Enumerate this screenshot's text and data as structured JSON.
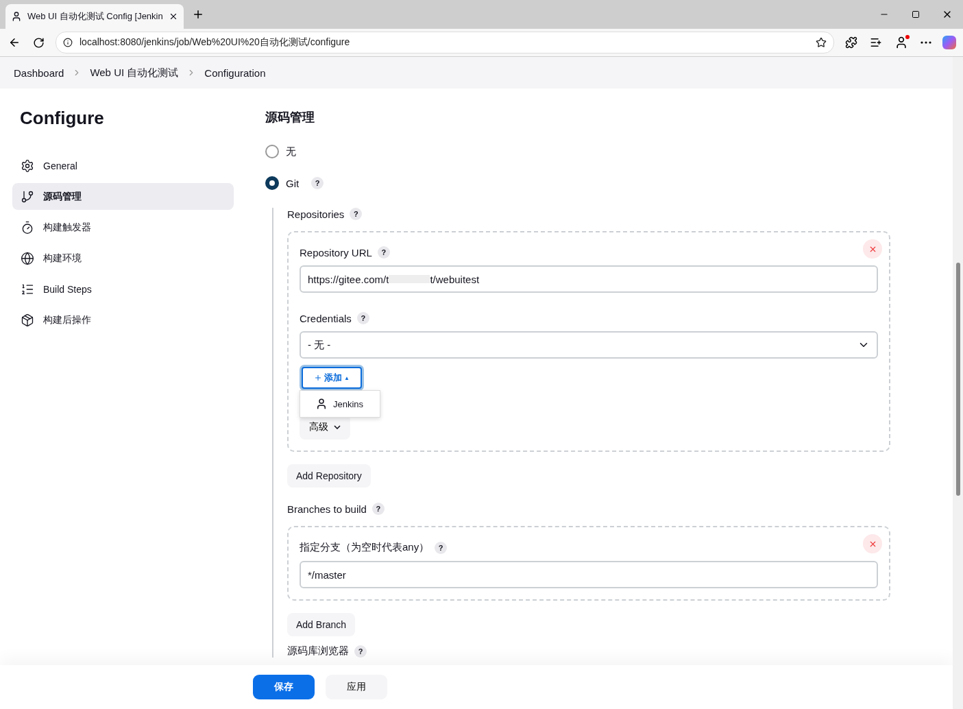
{
  "browser": {
    "tab_title": "Web UI 自动化测试 Config [Jenkin",
    "url": "localhost:8080/jenkins/job/Web%20UI%20自动化测试/configure"
  },
  "breadcrumbs": [
    "Dashboard",
    "Web UI 自动化测试",
    "Configuration"
  ],
  "sidebar": {
    "title": "Configure",
    "items": [
      {
        "label": "General",
        "selected": false
      },
      {
        "label": "源码管理",
        "selected": true
      },
      {
        "label": "构建触发器",
        "selected": false
      },
      {
        "label": "构建环境",
        "selected": false
      },
      {
        "label": "Build Steps",
        "selected": false
      },
      {
        "label": "构建后操作",
        "selected": false
      }
    ]
  },
  "scm": {
    "title": "源码管理",
    "options": [
      {
        "label": "无",
        "selected": false
      },
      {
        "label": "Git",
        "selected": true,
        "help": "?"
      }
    ],
    "repositories": {
      "label": "Repositories",
      "help": "?",
      "url_label": "Repository URL",
      "url_help": "?",
      "url_value": "https://gitee.com/t",
      "url_value_end": "t/webuitest",
      "credentials_label": "Credentials",
      "credentials_help": "?",
      "credentials_value": "- 无 -",
      "add_button": "添加",
      "add_caret": "▲",
      "add_menu": [
        "Jenkins"
      ],
      "advanced": "高级",
      "add_repository": "Add Repository"
    },
    "branches": {
      "label": "Branches to build",
      "help": "?",
      "spec_label": "指定分支（为空时代表any）",
      "spec_help": "?",
      "spec_value": "*/master",
      "add_branch": "Add Branch"
    },
    "browser_label": "源码库浏览器",
    "browser_help": "?"
  },
  "footer": {
    "save": "保存",
    "apply": "应用"
  }
}
